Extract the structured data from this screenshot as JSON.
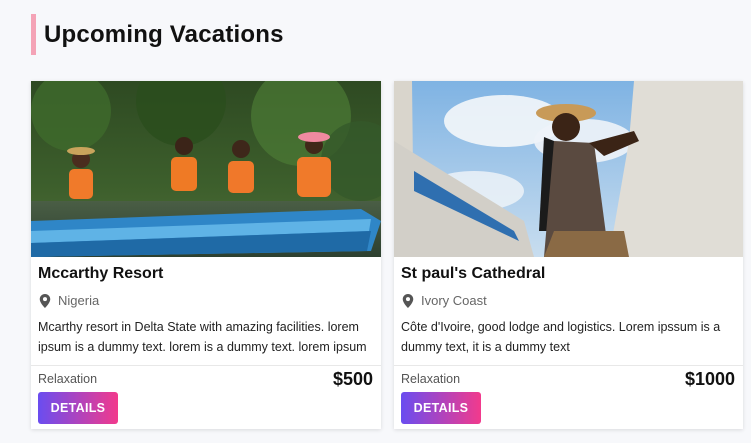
{
  "page": {
    "title": "Upcoming Vacations"
  },
  "cards": [
    {
      "title": "Mccarthy Resort",
      "location": "Nigeria",
      "description": "Mcarthy resort in Delta State with amazing facilities. lorem ipsum is a dummy text. lorem is a dummy text. lorem ipsum",
      "category": "Relaxation",
      "price": "$500",
      "button_label": "DETAILS"
    },
    {
      "title": "St paul's Cathedral",
      "location": "Ivory Coast",
      "description": "Côte d'Ivoire, good lodge and logistics. Lorem ipssum is a dummy text, it is a dummy text",
      "category": "Relaxation",
      "price": "$1000",
      "button_label": "DETAILS"
    }
  ],
  "colors": {
    "accent_bar": "#f4a3b6",
    "button_gradient_start": "#6a4df0",
    "button_gradient_end": "#f23a8c"
  },
  "icons": {
    "location": "map-pin-icon"
  }
}
